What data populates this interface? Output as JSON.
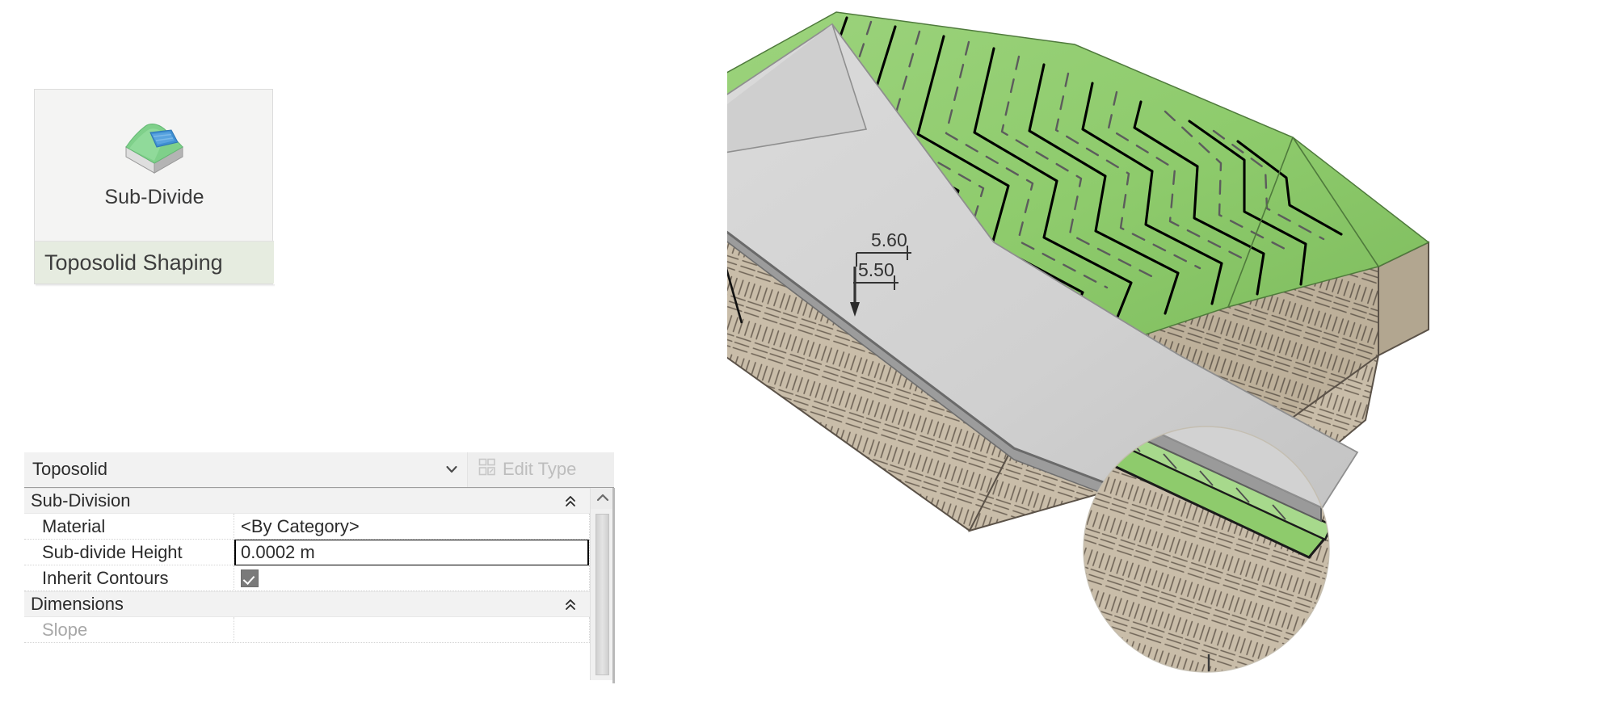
{
  "ribbon": {
    "accent_color": "#8cb843",
    "button": {
      "label": "Sub-Divide",
      "icon": "toposolid-subdivide-icon"
    },
    "panel_title": "Toposolid Shaping"
  },
  "properties": {
    "type_selector": {
      "value": "Toposolid",
      "dropdown_icon": "chevron-down-icon"
    },
    "edit_type": {
      "label": "Edit Type",
      "icon": "edit-type-icon",
      "enabled": false
    },
    "sections": [
      {
        "name": "Sub-Division",
        "collapse_icon": "double-chevron-up-icon",
        "rows": [
          {
            "name": "Material",
            "value": "<By Category>",
            "kind": "text",
            "disabled": false
          },
          {
            "name": "Sub-divide Height",
            "value": "0.0002 m",
            "kind": "input",
            "disabled": false
          },
          {
            "name": "Inherit Contours",
            "value": "",
            "kind": "checkbox",
            "checked": true,
            "disabled": false
          }
        ]
      },
      {
        "name": "Dimensions",
        "collapse_icon": "double-chevron-up-icon",
        "rows": [
          {
            "name": "Slope",
            "value": "",
            "kind": "text",
            "disabled": true
          }
        ]
      }
    ],
    "scrollbar": {
      "up_icon": "chevron-up-icon"
    }
  },
  "model_view": {
    "name": "toposolid-3d-view",
    "colors": {
      "terrain_green": "#8ecb6c",
      "terrain_green_light": "#9fd47f",
      "terrain_green_dark": "#7fbb5e",
      "slab_grey": "#d2d2d2",
      "slab_grey_dark": "#b8b8b8",
      "slab_edge": "#8f8f8f",
      "earth_tan": "#c9bda9",
      "earth_tan_dark": "#bdb09a",
      "contour_major": "#000000",
      "contour_minor": "#6f6f6f"
    },
    "annotations": [
      {
        "name": "spot-elevation-upper",
        "text": "5.60"
      },
      {
        "name": "spot-elevation-lower",
        "text": "5.50"
      }
    ]
  }
}
